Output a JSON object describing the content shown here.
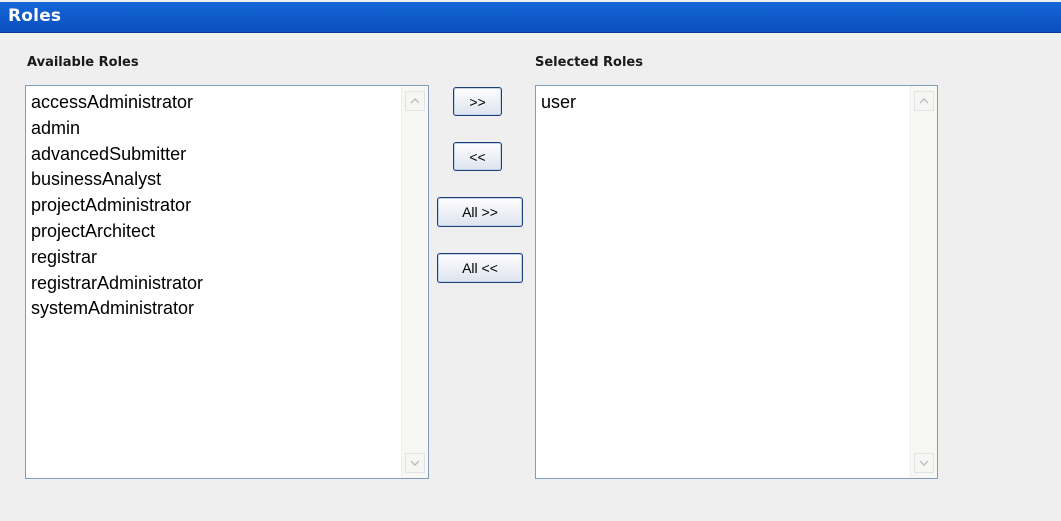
{
  "header": {
    "title": "Roles"
  },
  "available": {
    "label": "Available Roles",
    "items": [
      "accessAdministrator",
      "admin",
      "advancedSubmitter",
      "businessAnalyst",
      "projectAdministrator",
      "projectArchitect",
      "registrar",
      "registrarAdministrator",
      "systemAdministrator"
    ]
  },
  "selected": {
    "label": "Selected Roles",
    "items": [
      "user"
    ]
  },
  "buttons": {
    "add": ">>",
    "remove": "<<",
    "add_all": "All >>",
    "remove_all": "All <<"
  },
  "icons": {
    "scroll_up": "chevron-up-icon",
    "scroll_down": "chevron-down-icon"
  },
  "colors": {
    "header_bg": "#0a56c9",
    "header_text": "#ffffff",
    "list_border": "#7f9db9",
    "button_border": "#1b3f78"
  }
}
